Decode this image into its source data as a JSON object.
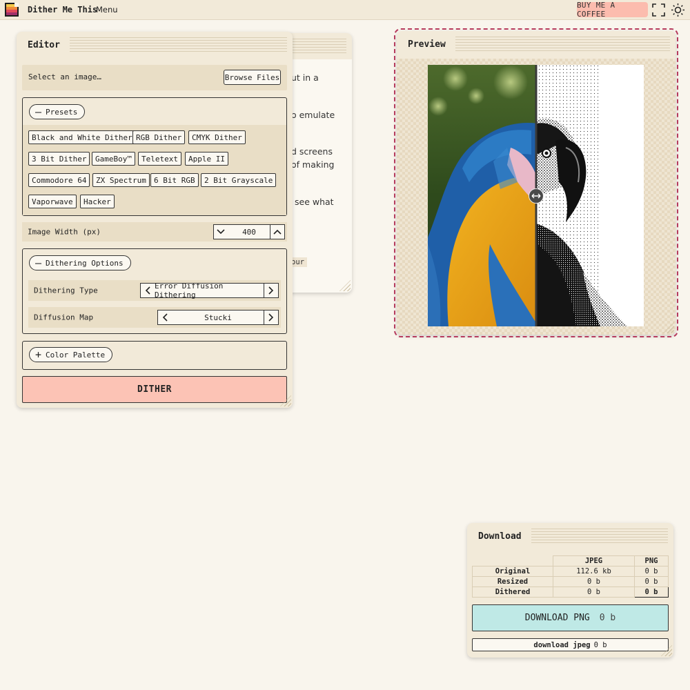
{
  "app": {
    "title": "Dither Me This",
    "menu_label": "Menu",
    "coffee_label": "BUY ME A COFFEE"
  },
  "colors": {
    "accent_dashed": "#b63b5d",
    "dither_button": "#fcc3b5",
    "download_button": "#bfe9e6",
    "coffee_button": "#fcbcae"
  },
  "icons": {
    "fullscreen": "fullscreen-icon",
    "theme": "sun-icon",
    "logo": "app-logo-icon"
  },
  "background_window": {
    "fragments": [
      "ut in a",
      "o emulate",
      "d screens",
      "of making",
      "see what",
      "our"
    ]
  },
  "editor": {
    "title": "Editor",
    "select_label": "Select an image…",
    "browse_label": "Browse Files",
    "presets": {
      "label": "Presets",
      "toggle_symbol": "—",
      "items": [
        "Black and White Dither",
        "RGB Dither",
        "CMYK Dither",
        "3 Bit Dither",
        "GameBoy™",
        "Teletext",
        "Apple II",
        "Commodore 64",
        "ZX Spectrum",
        "6 Bit RGB",
        "2 Bit Grayscale",
        "Vaporwave",
        "Hacker"
      ]
    },
    "image_width": {
      "label": "Image Width (px)",
      "value": "400"
    },
    "dithering_options": {
      "label": "Dithering Options",
      "toggle_symbol": "—",
      "type_label": "Dithering Type",
      "type_value": "Error Diffusion Dithering",
      "map_label": "Diffusion Map",
      "map_value": "Stucki"
    },
    "color_palette": {
      "label": "Color Palette",
      "toggle_symbol": "+"
    },
    "dither_label": "DITHER"
  },
  "preview": {
    "title": "Preview",
    "split_fraction": 0.5
  },
  "download": {
    "title": "Download",
    "columns": [
      "JPEG",
      "PNG"
    ],
    "rows": [
      {
        "label": "Original",
        "jpeg": "112.6 kb",
        "png": "0 b"
      },
      {
        "label": "Resized",
        "jpeg": "0 b",
        "png": "0 b"
      },
      {
        "label": "Dithered",
        "jpeg": "0 b",
        "png": "0 b"
      }
    ],
    "png_button_label": "DOWNLOAD PNG",
    "png_button_size": "0 b",
    "jpeg_button_label": "download jpeg",
    "jpeg_button_size": "0 b"
  }
}
